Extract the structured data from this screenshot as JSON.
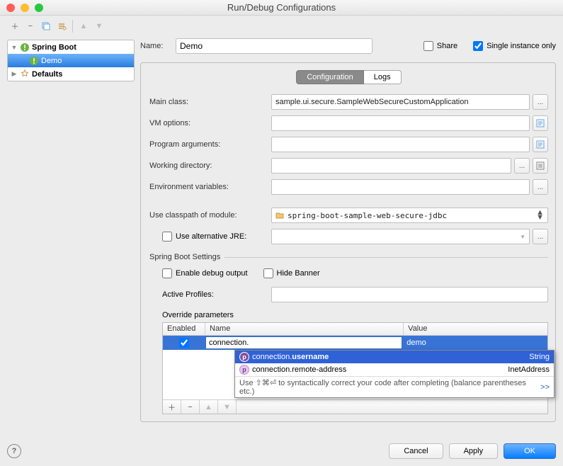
{
  "window": {
    "title": "Run/Debug Configurations"
  },
  "tree": {
    "root1": "Spring Boot",
    "child1": "Demo",
    "root2": "Defaults"
  },
  "nameRow": {
    "label": "Name:",
    "value": "Demo",
    "share": "Share",
    "single": "Single instance only"
  },
  "tabs": {
    "t1": "Configuration",
    "t2": "Logs"
  },
  "form": {
    "mainClassLbl": "Main class:",
    "mainClassVal": "sample.ui.secure.SampleWebSecureCustomApplication",
    "vmLbl": "VM options:",
    "argsLbl": "Program arguments:",
    "wdLbl": "Working directory:",
    "envLbl": "Environment variables:",
    "cpLbl": "Use classpath of module:",
    "cpVal": "spring-boot-sample-web-secure-jdbc",
    "altJre": "Use alternative JRE:",
    "sbSettings": "Spring Boot Settings",
    "debugOut": "Enable debug output",
    "hideBanner": "Hide Banner",
    "profilesLbl": "Active Profiles:",
    "overrideLbl": "Override parameters",
    "ovCol1": "Enabled",
    "ovCol2": "Name",
    "ovCol3": "Value",
    "ovNameVal": "connection.",
    "ovValueVal": "demo"
  },
  "completion": {
    "r1pre": "connection.",
    "r1match": "username",
    "r1type": "String",
    "r2pre": "connection.",
    "r2match": "remote-address",
    "r2type": "InetAddress",
    "hint": "Use ⇧⌘⏎ to syntactically correct your code after completing (balance parentheses etc.)",
    "more": ">>"
  },
  "buttons": {
    "cancel": "Cancel",
    "apply": "Apply",
    "ok": "OK"
  },
  "ellipsis": "..."
}
